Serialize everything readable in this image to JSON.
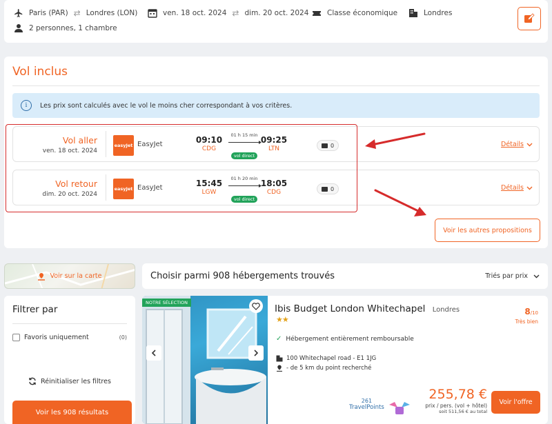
{
  "search": {
    "from": "Paris (PAR)",
    "to": "Londres (LON)",
    "date_start": "ven. 18 oct. 2024",
    "date_end": "dim. 20 oct. 2024",
    "cabin": "Classe économique",
    "destination": "Londres",
    "travelers": "2 personnes, 1 chambre"
  },
  "flights": {
    "title": "Vol inclus",
    "info": "Les prix sont calculés avec le vol le moins cher correspondant à vos critères.",
    "info_icon": "i",
    "outbound": {
      "label": "Vol aller",
      "date": "ven. 18 oct. 2024",
      "logo_text": "easyJet",
      "airline": "EasyJet",
      "dep_time": "09:10",
      "dep_code": "CDG",
      "duration": "01 h 15 min",
      "direct": "vol direct",
      "arr_time": "09:25",
      "arr_code": "LTN",
      "bags": "0",
      "details": "Détails"
    },
    "return": {
      "label": "Vol retour",
      "date": "dim. 20 oct. 2024",
      "logo_text": "easyJet",
      "airline": "EasyJet",
      "dep_time": "15:45",
      "dep_code": "LGW",
      "duration": "01 h 20 min",
      "direct": "vol direct",
      "arr_time": "18:05",
      "arr_code": "CDG",
      "bags": "0",
      "details": "Détails"
    },
    "other_button": "Voir les autres propositions"
  },
  "map": {
    "label": "Voir sur la carte"
  },
  "results": {
    "title": "Choisir parmi 908 hébergements trouvés",
    "sort_label": "Triés par prix"
  },
  "filters": {
    "title": "Filtrer par",
    "favorites_label": "Favoris uniquement",
    "favorites_count": "(0)",
    "reset_label": "Réinitialiser les filtres",
    "see_results": "Voir les 908 résultats"
  },
  "hotel": {
    "badge": "NOTRE SÉLECTION",
    "name": "Ibis Budget London Whitechapel",
    "city": "Londres",
    "stars": "★★",
    "score": "8",
    "score_scale": "/10",
    "score_label": "Très bien",
    "refund": "Hébergement entièrement remboursable",
    "address": "100 Whitechapel road - E1 1JG",
    "distance": "- de 5 km du point recherché",
    "travelpoints_value": "261",
    "travelpoints_label": "TravelPoints",
    "price": "255,78 €",
    "price_unit": "prix / pers. (vol + hôtel)",
    "price_total": "soit 511,56 € au total",
    "offer_button": "Voir l'offre"
  },
  "colors": {
    "accent": "#f06424",
    "direct": "#22a35a",
    "info_bg": "#d9ecfa",
    "annotation": "#d62b2b"
  },
  "icons": [
    "plane-icon",
    "swap-icon",
    "calendar-icon",
    "ticket-icon",
    "building-icon",
    "person-icon",
    "edit-icon",
    "info-icon",
    "suitcase-icon",
    "chevron-down-icon",
    "map-pin-icon",
    "refresh-icon",
    "heart-icon",
    "chevron-left-icon",
    "chevron-right-icon",
    "check-icon",
    "location-icon"
  ]
}
